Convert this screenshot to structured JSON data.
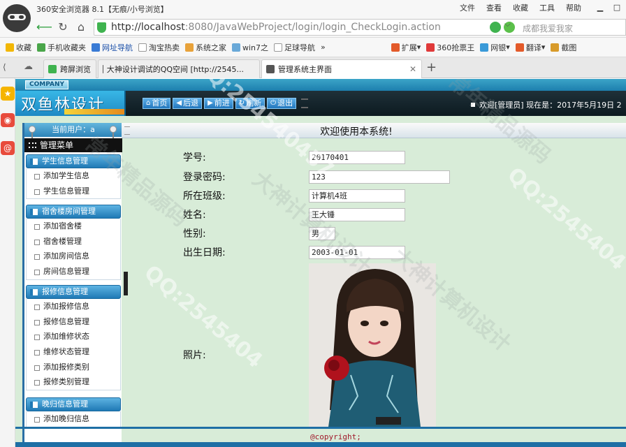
{
  "browser": {
    "title": "360安全浏览器 8.1【无痕/小号浏览】",
    "menu": [
      "文件",
      "查看",
      "收藏",
      "工具",
      "帮助"
    ],
    "url_host": "http://localhost",
    "url_path": ":8080/JavaWebProject/login/login_CheckLogin.action",
    "search_placeholder": "成都我爱我家",
    "favorites": [
      "收藏",
      "手机收藏夹",
      "网址导航",
      "淘宝热卖",
      "系统之家",
      "win7之",
      "足球导航",
      "»",
      "扩展",
      "360抢票王",
      "网银",
      "翻译",
      "截图"
    ],
    "tabs": [
      {
        "label": "跨屏浏览"
      },
      {
        "label": "大神设计调试的QQ空间 [http://2545..."
      },
      {
        "label": "管理系统主界面",
        "active": true
      }
    ],
    "new_tab": "+"
  },
  "page": {
    "company": "COMPANY",
    "brand": "双鱼林设计",
    "nav": [
      {
        "icon": "home-icon",
        "glyph": "⌂",
        "label": "首页"
      },
      {
        "icon": "back-icon",
        "glyph": "◀",
        "label": "后退"
      },
      {
        "icon": "forward-icon",
        "glyph": "▶",
        "label": "前进"
      },
      {
        "icon": "refresh-icon",
        "glyph": "↻",
        "label": "刷新"
      },
      {
        "icon": "logout-icon",
        "glyph": "⏻",
        "label": "退出"
      }
    ],
    "welcome": "欢迎[管理员]  现在是：2017年5月19日 2",
    "current_user": "当前用户：a",
    "menu_title": "管理菜单",
    "groups": [
      {
        "title": "学生信息管理",
        "items": [
          "添加学生信息",
          "学生信息管理"
        ]
      },
      {
        "title": "宿舍楼房间管理",
        "items": [
          "添加宿舍楼",
          "宿舍楼管理",
          "添加房间信息",
          "房间信息管理"
        ]
      },
      {
        "title": "报修信息管理",
        "items": [
          "添加报修信息",
          "报修信息管理",
          "添加维修状态",
          "维修状态管理",
          "添加报修类别",
          "报修类别管理"
        ]
      },
      {
        "title": "晚归信息管理",
        "items": [
          "添加晚归信息"
        ]
      }
    ],
    "content_title": "欢迎使用本系统!",
    "form": {
      "student_no_label": "学号:",
      "student_no": "20170401",
      "password_label": "登录密码:",
      "password": "123",
      "class_label": "所在班级:",
      "class": "计算机4班",
      "name_label": "姓名:",
      "name": "王大锤",
      "gender_label": "性别:",
      "gender": "男",
      "birth_label": "出生日期:",
      "birth": "2003-01-01",
      "photo_label": "照片:"
    },
    "copyright": "@copyright;"
  },
  "watermarks": [
    "QQ:254540457",
    "大神计算机设计",
    "常年精品源码",
    "QQ:2545404",
    "大神计算机设计",
    "QQ:2545404",
    "常年精品源码"
  ],
  "colors": {
    "accent": "#1e6fa5",
    "page_bg": "#d8ecd8"
  }
}
